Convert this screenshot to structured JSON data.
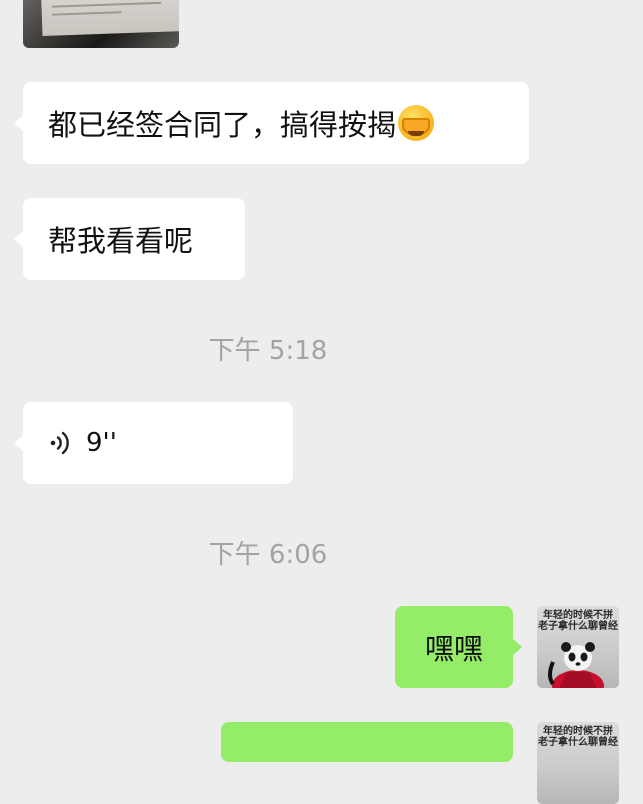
{
  "chat": {
    "messages": {
      "m1": "都已经签合同了，搞得按揭",
      "m2": "帮我看看呢",
      "m3_duration": "9''",
      "m4": "嘿嘿"
    },
    "timestamps": {
      "t1": "下午 5:18",
      "t2": "下午 6:06"
    },
    "avatar_caption": "年轻的时候不拼\n老子拿什么聊曾经"
  },
  "icons": {
    "emoji": "facepalm-emoji",
    "voice": "voice-wave-icon",
    "avatar": "panda-avatar"
  },
  "colors": {
    "background": "#ededed",
    "incoming_bubble": "#ffffff",
    "outgoing_bubble": "#95ec69",
    "timestamp_text": "#a3a3a3"
  }
}
